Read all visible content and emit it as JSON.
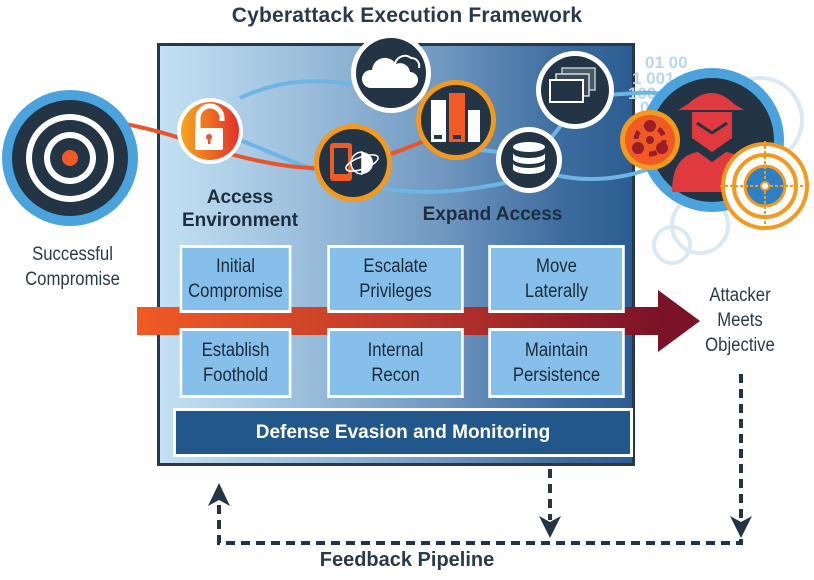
{
  "title": "Cyberattack Execution Framework",
  "left_node": {
    "label_line1": "Successful",
    "label_line2": "Compromise",
    "icon": "bullseye-target-icon"
  },
  "right_node": {
    "label_line1": "Attacker",
    "label_line2": "Meets",
    "label_line3": "Objective",
    "icon": "hooded-attacker-icon"
  },
  "stages": {
    "access": {
      "line1": "Access",
      "line2": "Environment"
    },
    "expand": {
      "label": "Expand Access"
    }
  },
  "steps": [
    {
      "line1": "Initial",
      "line2": "Compromise"
    },
    {
      "line1": "Escalate",
      "line2": "Privileges"
    },
    {
      "line1": "Move",
      "line2": "Laterally"
    },
    {
      "line1": "Establish",
      "line2": "Foothold"
    },
    {
      "line1": "Internal",
      "line2": "Recon"
    },
    {
      "line1": "Maintain",
      "line2": "Persistence"
    }
  ],
  "defense_bar": "Defense Evasion and Monitoring",
  "feedback_label": "Feedback Pipeline",
  "binary_text": [
    "01 00",
    "1 001",
    "100",
    "0"
  ],
  "icons": [
    "unlocked-padlock-icon",
    "cloud-icon",
    "mobile-globe-icon",
    "servers-icon",
    "database-icon",
    "windows-icon",
    "biohazard-icon",
    "crosshair-target-icon"
  ],
  "colors": {
    "dark_navy": "#233444",
    "accent_orange": "#f39a1e",
    "red_orange": "#e8552a",
    "maroon": "#7d1428",
    "light_blue": "#5aa9dc",
    "box_blue": "#86c0ea",
    "defense_blue": "#21578b",
    "attacker_red": "#e03a3e"
  }
}
